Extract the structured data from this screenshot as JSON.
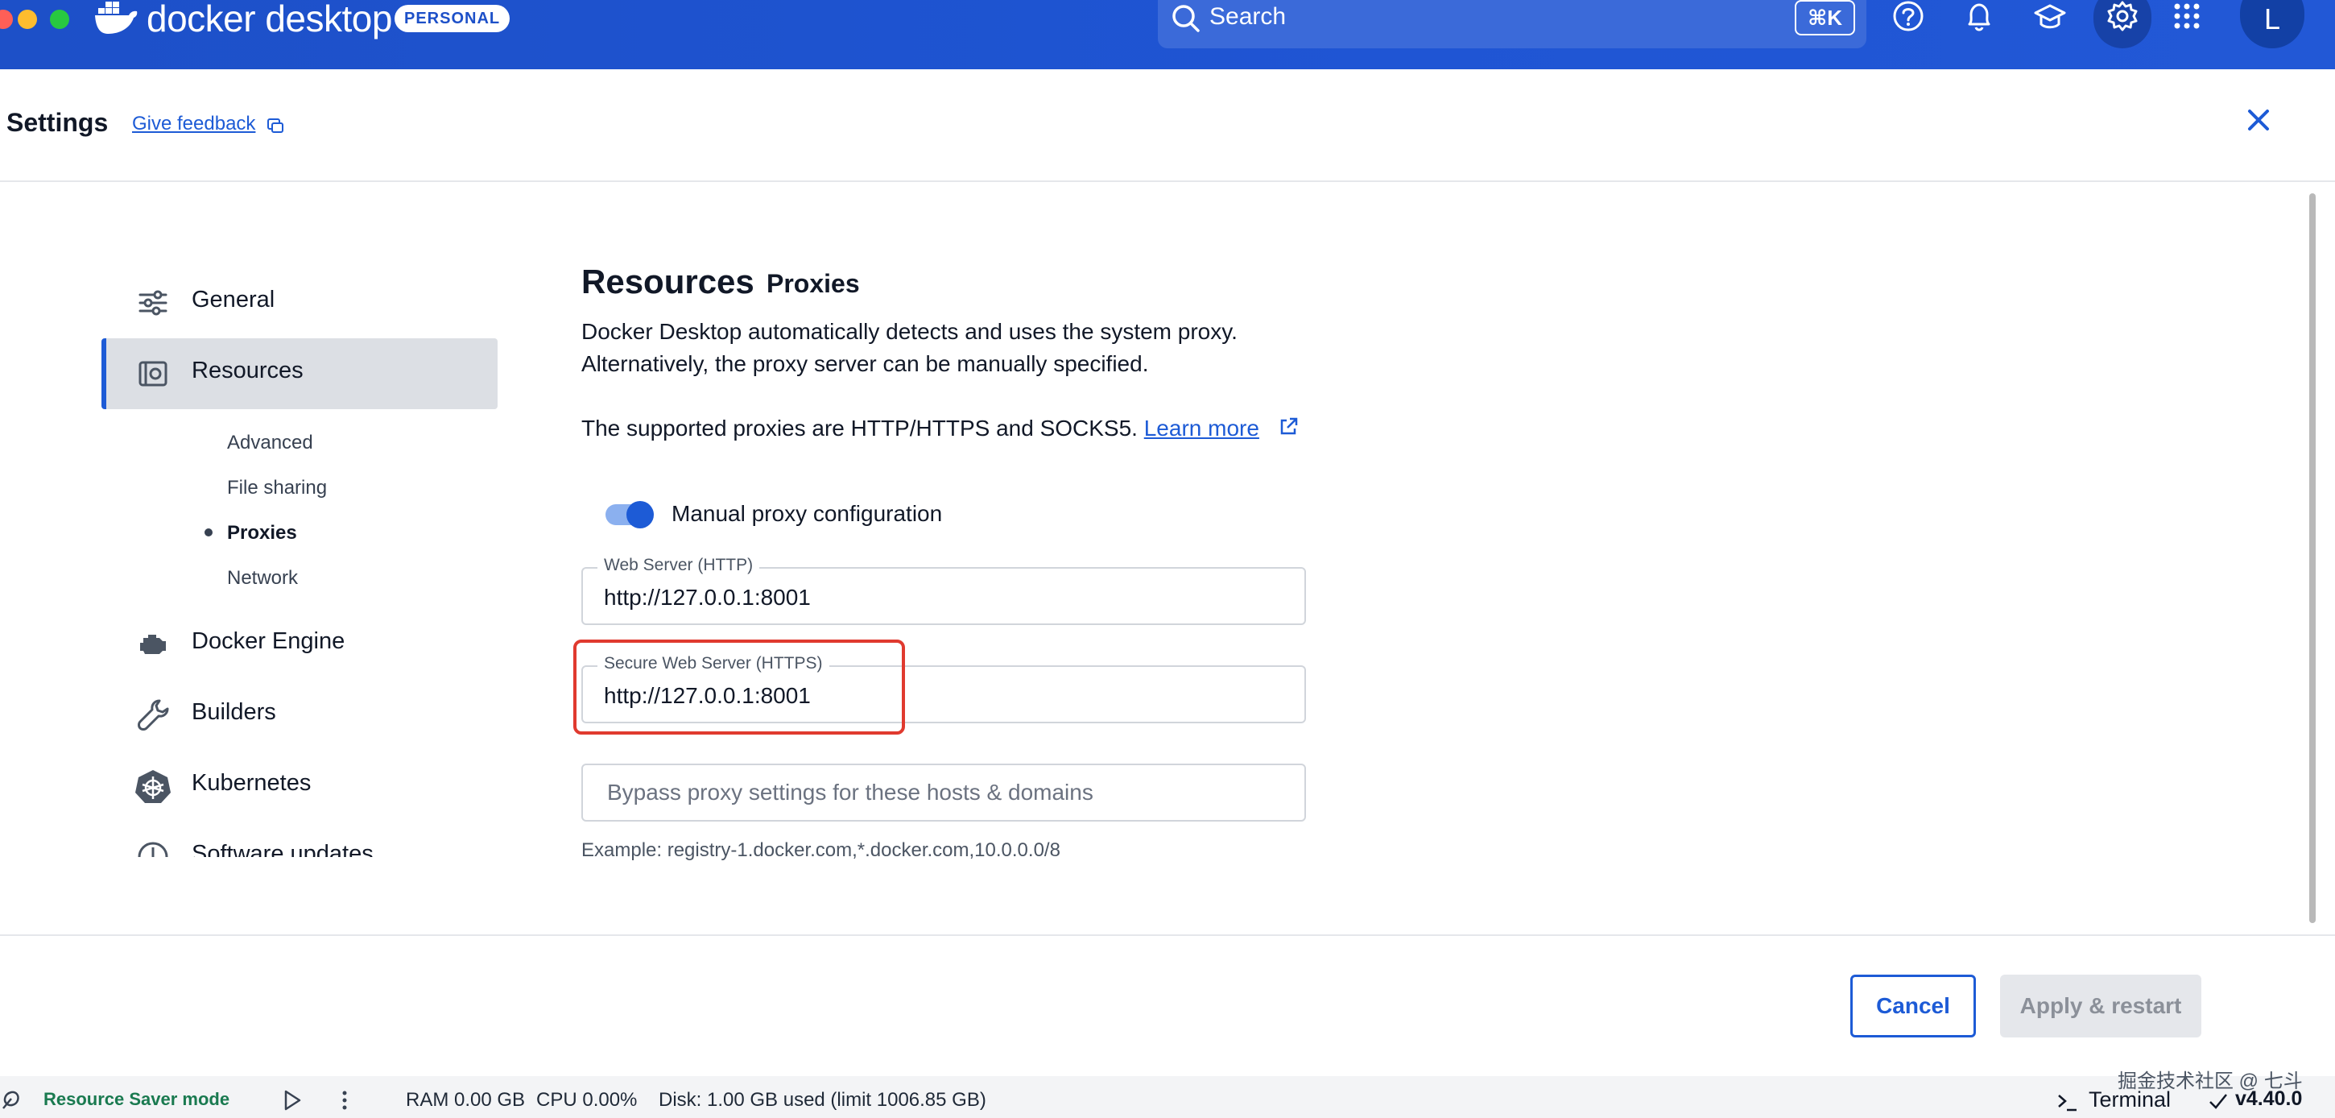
{
  "app": {
    "brand": "docker desktop",
    "badge": "PERSONAL"
  },
  "topbar": {
    "search_placeholder": "Search",
    "search_shortcut": "⌘K",
    "avatar_letter": "L"
  },
  "header": {
    "title": "Settings",
    "feedback_label": "Give feedback"
  },
  "sidebar": {
    "items": [
      {
        "label": "General",
        "icon": "sliders-icon"
      },
      {
        "label": "Resources",
        "icon": "resources-icon"
      },
      {
        "label": "Docker Engine",
        "icon": "engine-icon"
      },
      {
        "label": "Builders",
        "icon": "wrench-icon"
      },
      {
        "label": "Kubernetes",
        "icon": "kubernetes-icon"
      },
      {
        "label": "Software updates",
        "icon": "clock-icon"
      }
    ],
    "resources_sub": [
      {
        "label": "Advanced"
      },
      {
        "label": "File sharing"
      },
      {
        "label": "Proxies"
      },
      {
        "label": "Network"
      }
    ]
  },
  "main": {
    "title": "Resources",
    "subtitle": "Proxies",
    "desc_line1": "Docker Desktop automatically detects and uses the system proxy.",
    "desc_line2": "Alternatively, the proxy server can be manually specified.",
    "supported_text": "The supported proxies are HTTP/HTTPS and SOCKS5. ",
    "learn_more": "Learn more",
    "toggle_label": "Manual proxy configuration",
    "toggle_on": true,
    "http_label": "Web Server (HTTP)",
    "http_value": "http://127.0.0.1:8001",
    "https_label": "Secure Web Server (HTTPS)",
    "https_value": "http://127.0.0.1:8001",
    "bypass_placeholder": "Bypass proxy settings for these hosts & domains",
    "example": "Example: registry-1.docker.com,*.docker.com,10.0.0.0/8"
  },
  "footer": {
    "cancel_label": "Cancel",
    "apply_label": "Apply & restart"
  },
  "statusbar": {
    "saver_label": "Resource Saver mode",
    "ram": "RAM 0.00 GB",
    "cpu": "CPU 0.00%",
    "disk": "Disk: 1.00 GB used (limit 1006.85 GB)",
    "terminal": "Terminal",
    "version": "v4.40.0",
    "watermark": "掘金技术社区 @ 七斗"
  },
  "colors": {
    "brand_blue": "#1d50c8",
    "accent": "#1d5bd6",
    "highlight": "#e03a2f",
    "saver_green": "#1a7a50"
  }
}
